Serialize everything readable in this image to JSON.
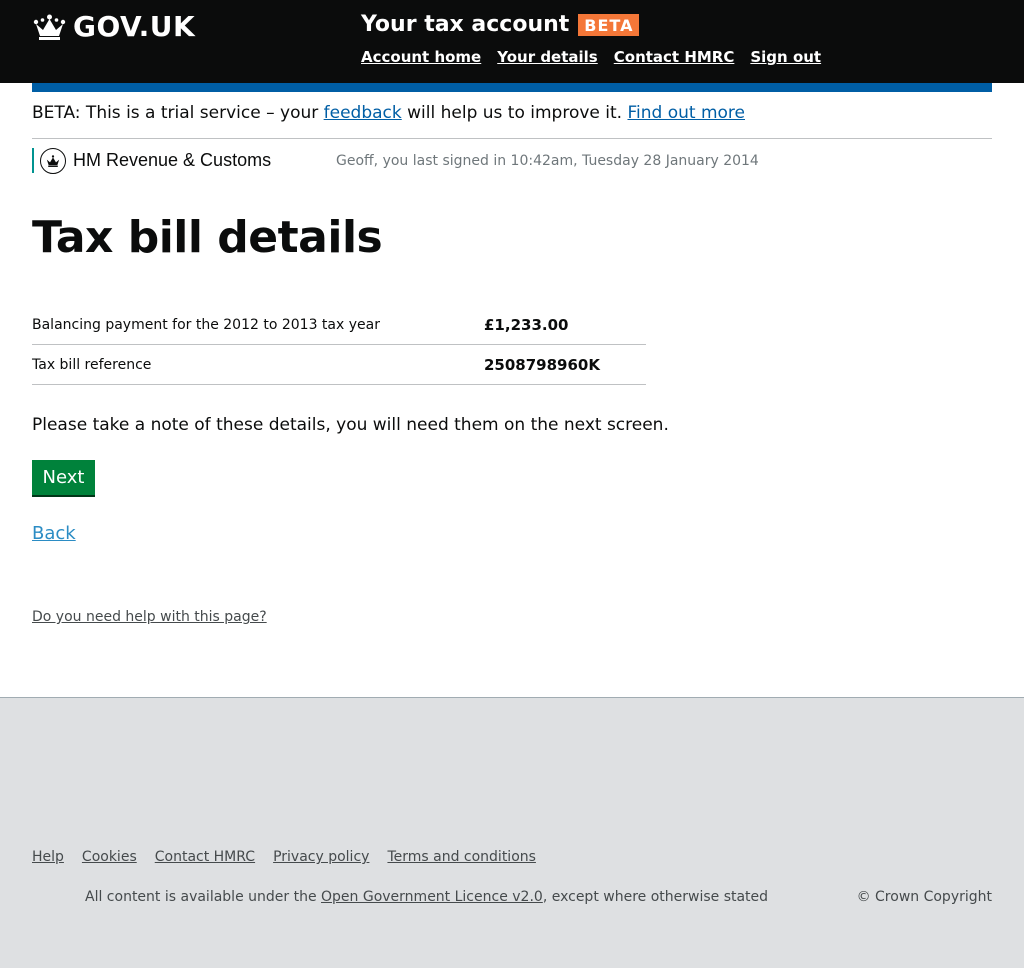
{
  "header": {
    "logo_text": "GOV.UK",
    "service_name": "Your tax account",
    "beta_badge": "BETA",
    "nav": [
      "Account home",
      "Your details",
      "Contact HMRC",
      "Sign out"
    ]
  },
  "beta_banner": {
    "prefix": "BETA: This is a trial service – your ",
    "feedback_link": "feedback",
    "middle": " will help us to improve it. ",
    "find_out_link": "Find out more"
  },
  "org": {
    "name": "HM Revenue & Customs",
    "last_signed_in": "Geoff, you last signed in 10:42am, Tuesday 28 January 2014"
  },
  "main": {
    "title": "Tax bill details",
    "rows": [
      {
        "key": "Balancing payment for the 2012 to 2013 tax year",
        "value": "£1,233.00"
      },
      {
        "key": "Tax bill reference",
        "value": "2508798960K"
      }
    ],
    "note": "Please take a note of these details, you will need them on the next screen.",
    "next_button": "Next",
    "back_link": "Back",
    "help_link": "Do you need help with this page?"
  },
  "footer": {
    "links": [
      "Help",
      "Cookies",
      "Contact HMRC",
      "Privacy policy",
      "Terms and conditions"
    ],
    "licence_prefix": "All content is available under the ",
    "licence_link": "Open Government Licence v2.0",
    "licence_suffix": ", except where otherwise stated",
    "copyright": "© Crown Copyright"
  },
  "colors": {
    "header_bg": "#0b0c0c",
    "beta_badge": "#f47738",
    "blue_bar": "#005ea5",
    "link": "#005ea5",
    "button": "#00823b",
    "footer_bg": "#dee0e2",
    "org_accent": "#009390"
  }
}
